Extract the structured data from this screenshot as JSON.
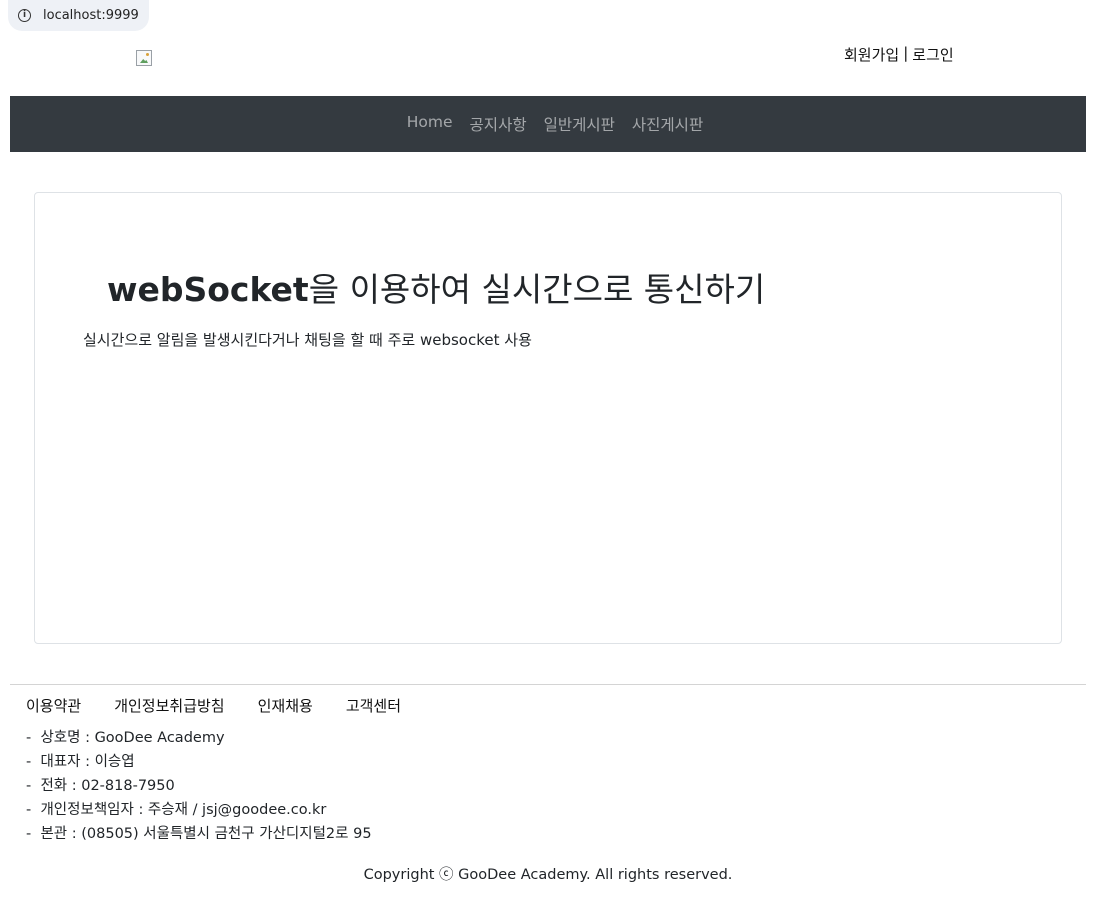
{
  "browser": {
    "url": "localhost:9999",
    "info_icon": "info-icon"
  },
  "header": {
    "logo_icon": "broken-image-icon",
    "signup_label": "회원가입",
    "separator": "|",
    "login_label": "로그인"
  },
  "nav": {
    "items": [
      {
        "label": "Home"
      },
      {
        "label": "공지사항"
      },
      {
        "label": "일반게시판"
      },
      {
        "label": "사진게시판"
      }
    ]
  },
  "main": {
    "title_bold": "webSocket",
    "title_rest": "을 이용하여 실시간으로 통신하기",
    "subtitle": "실시간으로 알림을 발생시킨다거나 채팅을 할 때 주로 websocket 사용"
  },
  "footer": {
    "links": [
      {
        "label": "이용약관"
      },
      {
        "label": "개인정보취급방침"
      },
      {
        "label": "인재채용"
      },
      {
        "label": "고객센터"
      }
    ],
    "company": [
      "상호명 : GooDee Academy",
      "대표자 : 이승엽",
      "전화 : 02-818-7950",
      "개인정보책임자 : 주승재 / jsj@goodee.co.kr",
      "본관 : (08505) 서울특별시 금천구 가산디지털2로 95"
    ],
    "copyright": "Copyright ⓒ GooDee Academy. All rights reserved."
  }
}
